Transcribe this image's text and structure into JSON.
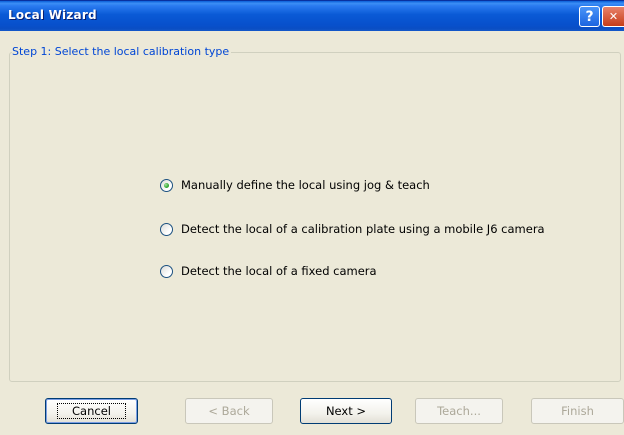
{
  "window": {
    "title": "Local Wizard"
  },
  "titlebar_buttons": {
    "help": "?",
    "close": "✕"
  },
  "step": {
    "legend": "Step 1: Select the local calibration type"
  },
  "options": [
    {
      "label": "Manually define the local using jog & teach",
      "checked": true
    },
    {
      "label": "Detect the local of a calibration plate using a mobile J6 camera",
      "checked": false
    },
    {
      "label": "Detect the local of a fixed camera",
      "checked": false
    }
  ],
  "buttons": {
    "cancel": "Cancel",
    "back": "< Back",
    "next": "Next >",
    "teach": "Teach...",
    "finish": "Finish"
  }
}
